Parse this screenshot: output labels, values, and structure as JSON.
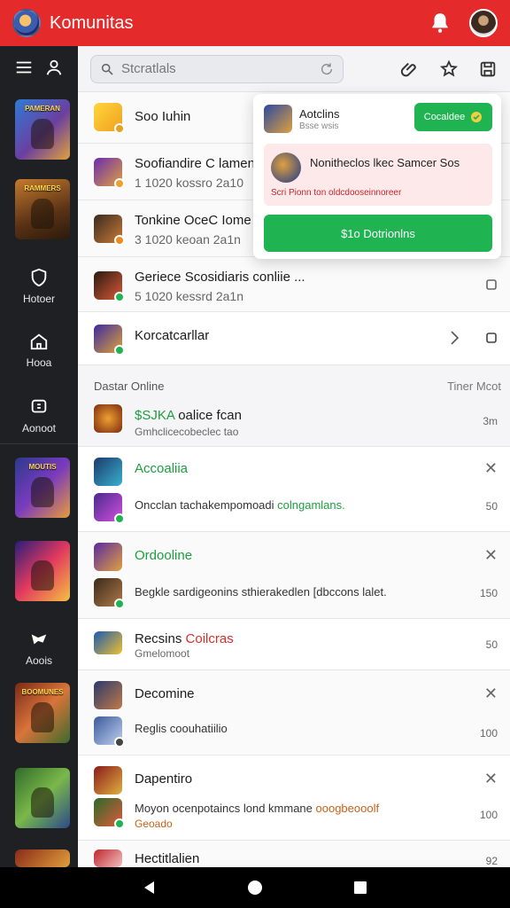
{
  "app": {
    "title": "Komunitas"
  },
  "search": {
    "placeholder": "Stcratlals"
  },
  "rail": {
    "nav": [
      {
        "label": "Hotoer"
      },
      {
        "label": "Hooa"
      },
      {
        "label": "Aonoot"
      },
      {
        "label": "Aoois"
      }
    ],
    "thumbs": [
      {
        "caption": "PAMERAN"
      },
      {
        "caption": "RAMMERS"
      },
      {
        "caption": "MOUTIS"
      },
      {
        "caption": ""
      },
      {
        "caption": "BOOMUNES"
      },
      {
        "caption": ""
      },
      {
        "caption": ""
      }
    ]
  },
  "list": {
    "rows": [
      {
        "title": "Soo Iuhin",
        "sub": ""
      },
      {
        "title": "Soofiandire C lamenc",
        "sub": "1 1020 kossro 2a10"
      },
      {
        "title": "Tonkine OceC Iome C",
        "sub": "3 1020 keoan 2a1n"
      },
      {
        "title": "Geriece Scosidiaris conliie ...",
        "sub": "5 1020 kessrd 2a1n"
      },
      {
        "title": "Korcatcarllar",
        "sub": ""
      }
    ]
  },
  "online": {
    "heading": "Dastar Online",
    "right": "Tiner Mcot",
    "item": {
      "title_prefix": "$SJKA",
      "title_rest": " oalice fcan",
      "sub": "Gmhclicecobeclec tao",
      "time": "3m"
    }
  },
  "groups": [
    {
      "title": "Accoaliia",
      "msg_main": "Oncclan tachakempomoadi ",
      "msg_accent": "colngamlans.",
      "count": "50"
    },
    {
      "title": "Ordooline",
      "msg_main": "Begkle sardigeonins sthierakedlen [dbccons lalet.",
      "msg_accent": "",
      "count": "150"
    },
    {
      "title_main": "Recsins ",
      "title_accent": "Coilcras",
      "sub": "Gmelomoot",
      "count": "50"
    },
    {
      "title": "Decomine",
      "msg_main": "Reglis coouhatiilio",
      "msg_accent": "",
      "count": "100"
    },
    {
      "title": "Dapentiro",
      "msg_main": "Moyon ocenpotaincs lond kmmane ",
      "msg_accent": "ooogbeooolf",
      "msg_line2": "Geoado",
      "count": "100"
    },
    {
      "title": "Hectitlalien",
      "count": "92"
    }
  ],
  "popup": {
    "name": "Aotclins",
    "sub": "Bsse wsis",
    "join_label": "Cocaldee",
    "notice_title": "Nonitheclos lkec Samcer Sos",
    "notice_sub": "Scri Pionn ton oldcdooseinnoreer",
    "big_button": "$1o Dotrionlns"
  },
  "colors": {
    "accent": "#e42a2a",
    "green": "#1fb351",
    "rail": "#1f2024"
  }
}
